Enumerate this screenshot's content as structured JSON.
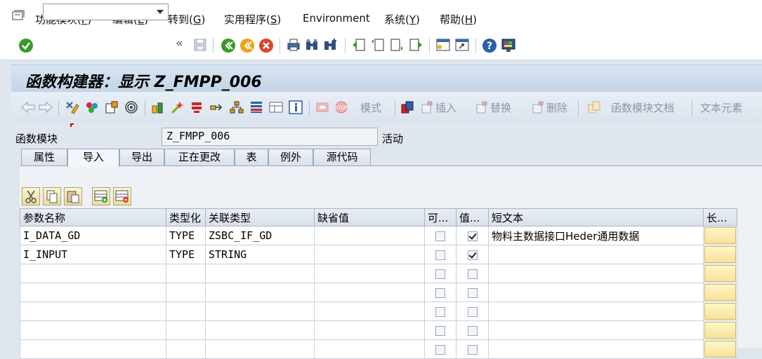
{
  "menu": {
    "items": [
      {
        "label": "功能模块",
        "key": "F"
      },
      {
        "label": "编辑",
        "key": "E"
      },
      {
        "label": "转到",
        "key": "G"
      },
      {
        "label": "实用程序",
        "key": "S"
      },
      {
        "label": "Environment",
        "key": ""
      },
      {
        "label": "系统",
        "key": "Y"
      },
      {
        "label": "帮助",
        "key": "H"
      }
    ]
  },
  "toolbar": {
    "command_value": "",
    "icons": [
      "enter-icon",
      "command-field",
      "back-history-icon",
      "save-icon",
      "back-icon",
      "exit-icon",
      "cancel-icon",
      "print-icon",
      "find-icon",
      "find-next-icon",
      "first-page-icon",
      "previous-page-icon",
      "next-page-icon",
      "last-page-icon",
      "create-session-icon",
      "create-shortcut-icon",
      "help-icon",
      "customize-layout-icon"
    ]
  },
  "title": "函数构建器：显示 Z_FMPP_006",
  "app_toolbar": {
    "mode_label": "模式",
    "insert_label": "插入",
    "replace_label": "替换",
    "delete_label": "删除",
    "doc_label": "函数模块文档",
    "text_label": "文本元素"
  },
  "function_module": {
    "label": "函数模块",
    "value": "Z_FMPP_006",
    "status": "活动"
  },
  "tabs": [
    {
      "label": "属性",
      "active": false
    },
    {
      "label": "导入",
      "active": true
    },
    {
      "label": "导出",
      "active": false
    },
    {
      "label": "正在更改",
      "active": false
    },
    {
      "label": "表",
      "active": false
    },
    {
      "label": "例外",
      "active": false
    },
    {
      "label": "源代码",
      "active": false
    }
  ],
  "table": {
    "columns": [
      "参数名称",
      "类型化",
      "关联类型",
      "缺省值",
      "可...",
      "值...",
      "短文本",
      "长..."
    ],
    "rows": [
      {
        "name": "I_DATA_GD",
        "typing": "TYPE",
        "assoc_type": "ZSBC_IF_GD",
        "default": "",
        "optional": false,
        "pass_value": true,
        "short_text": "物料主数据接口Heder通用数据"
      },
      {
        "name": "I_INPUT",
        "typing": "TYPE",
        "assoc_type": "STRING",
        "default": "",
        "optional": false,
        "pass_value": true,
        "short_text": ""
      },
      {
        "name": "",
        "typing": "",
        "assoc_type": "",
        "default": "",
        "optional": false,
        "pass_value": false,
        "short_text": ""
      },
      {
        "name": "",
        "typing": "",
        "assoc_type": "",
        "default": "",
        "optional": false,
        "pass_value": false,
        "short_text": ""
      },
      {
        "name": "",
        "typing": "",
        "assoc_type": "",
        "default": "",
        "optional": false,
        "pass_value": false,
        "short_text": ""
      },
      {
        "name": "",
        "typing": "",
        "assoc_type": "",
        "default": "",
        "optional": false,
        "pass_value": false,
        "short_text": ""
      },
      {
        "name": "",
        "typing": "",
        "assoc_type": "",
        "default": "",
        "optional": false,
        "pass_value": false,
        "short_text": ""
      }
    ]
  },
  "colors": {
    "title_bg": "#c4d4e6",
    "len_button": "#f8e29a",
    "enter_green": "#3a9a2a",
    "cancel_red": "#d9472b"
  }
}
